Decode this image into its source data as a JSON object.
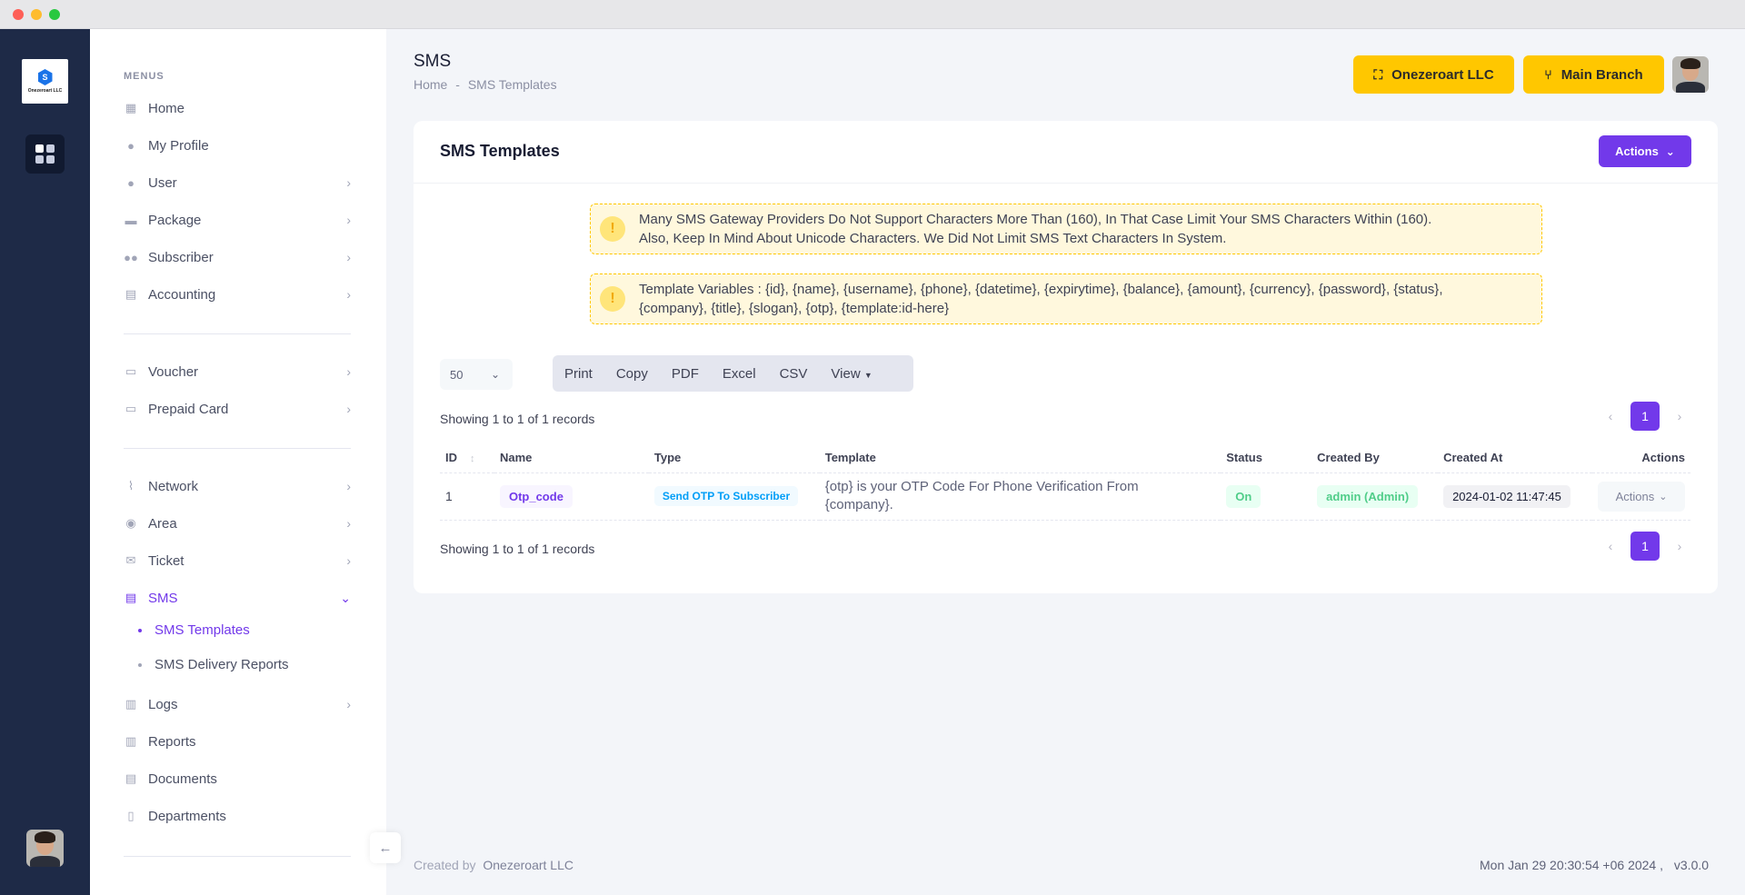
{
  "colors": {
    "accent": "#7239ea",
    "warning": "#ffc700",
    "rail": "#1e2a47"
  },
  "rail": {
    "logo_text": "Onezeroart LLC"
  },
  "sidebar": {
    "section_title": "MENUS",
    "items": [
      {
        "label": "Home",
        "icon": "home-icon"
      },
      {
        "label": "My Profile",
        "icon": "profile-icon"
      },
      {
        "label": "User",
        "icon": "user-icon"
      },
      {
        "label": "Package",
        "icon": "package-icon"
      },
      {
        "label": "Subscriber",
        "icon": "subscriber-icon"
      },
      {
        "label": "Accounting",
        "icon": "calculator-icon"
      },
      {
        "label": "Voucher",
        "icon": "voucher-icon"
      },
      {
        "label": "Prepaid Card",
        "icon": "card-icon"
      },
      {
        "label": "Network",
        "icon": "antenna-icon"
      },
      {
        "label": "Area",
        "icon": "location-icon"
      },
      {
        "label": "Ticket",
        "icon": "ticket-icon"
      },
      {
        "label": "SMS",
        "icon": "message-icon"
      },
      {
        "label": "Logs",
        "icon": "book-icon"
      },
      {
        "label": "Reports",
        "icon": "report-icon"
      },
      {
        "label": "Documents",
        "icon": "document-icon"
      },
      {
        "label": "Departments",
        "icon": "building-icon"
      }
    ],
    "sms_sub": [
      {
        "label": "SMS Templates"
      },
      {
        "label": "SMS Delivery Reports"
      }
    ]
  },
  "header": {
    "title": "SMS",
    "breadcrumb_home": "Home",
    "breadcrumb_sep": "-",
    "breadcrumb_current": "SMS Templates",
    "company_button": "Onezeroart LLC",
    "branch_button": "Main Branch"
  },
  "card": {
    "title": "SMS Templates",
    "actions_label": "Actions",
    "alert1_line1": "Many SMS Gateway Providers Do Not Support Characters More Than (160), In That Case Limit Your SMS Characters Within (160).",
    "alert1_line2": "Also, Keep In Mind About Unicode Characters. We Did Not Limit SMS Text Characters In System.",
    "alert2_line1": "Template Variables : {id}, {name}, {username}, {phone}, {datetime}, {expirytime}, {balance}, {amount}, {currency}, {password}, {status},",
    "alert2_line2": "{company}, {title}, {slogan}, {otp}, {template:id-here}",
    "page_length": "50",
    "export_buttons": [
      "Print",
      "Copy",
      "PDF",
      "Excel",
      "CSV",
      "View"
    ],
    "showing_top": "Showing 1 to 1 of 1 records",
    "showing_bottom": "Showing 1 to 1 of 1 records",
    "current_page": "1"
  },
  "table": {
    "columns": [
      "ID",
      "Name",
      "Type",
      "Template",
      "Status",
      "Created By",
      "Created At",
      "Actions"
    ],
    "rows": [
      {
        "id": "1",
        "name": "Otp_code",
        "type": "Send OTP To Subscriber",
        "template_line1": "{otp} is your OTP Code For Phone Verification From",
        "template_line2": "{company}.",
        "status": "On",
        "created_by": "admin (Admin)",
        "created_at": "2024-01-02 11:47:45",
        "actions": "Actions"
      }
    ]
  },
  "footer": {
    "created_by": "Created by",
    "company": "Onezeroart LLC",
    "datetime": "Mon Jan 29 20:30:54 +06 2024 ,",
    "version": "v3.0.0"
  }
}
